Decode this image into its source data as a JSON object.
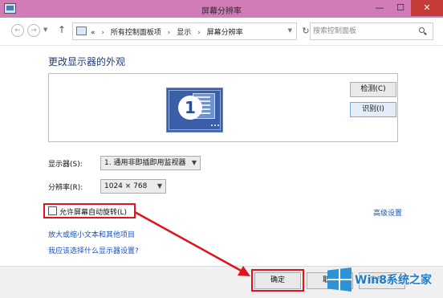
{
  "window": {
    "title": "屏幕分辨率",
    "controls": {
      "minimize": "—",
      "maximize": "☐",
      "close": "✕"
    }
  },
  "nav": {
    "back": "←",
    "forward": "→",
    "up": "↑",
    "breadcrumb_prefix": "«",
    "breadcrumbs": [
      "所有控制面板项",
      "显示",
      "屏幕分辨率"
    ],
    "refresh": "↻",
    "search_placeholder": "搜索控制面板"
  },
  "main": {
    "heading": "更改显示器的外观",
    "monitor_number": "1",
    "detect_button": "检测(C)",
    "identify_button": "识别(I)",
    "display_label": "显示器(S):",
    "display_value": "1. 通用非即插即用监视器",
    "resolution_label": "分辨率(R):",
    "resolution_value": "1024 × 768",
    "auto_rotate_label": "允许屏幕自动旋转(L)",
    "auto_rotate_checked": false,
    "advanced_link": "高级设置",
    "text_size_link": "放大或缩小文本和其他项目",
    "which_settings_link": "我应该选择什么显示器设置?"
  },
  "footer": {
    "ok_button": "确定",
    "cancel_button": "取消",
    "apply_button": "应用(A)"
  },
  "watermark": {
    "text": "Win8系统之家"
  },
  "colors": {
    "titlebar": "#d27cb7",
    "close_button": "#c63b38",
    "highlight": "#e0141b",
    "link": "#1a53b8",
    "heading": "#1e3b7d"
  }
}
